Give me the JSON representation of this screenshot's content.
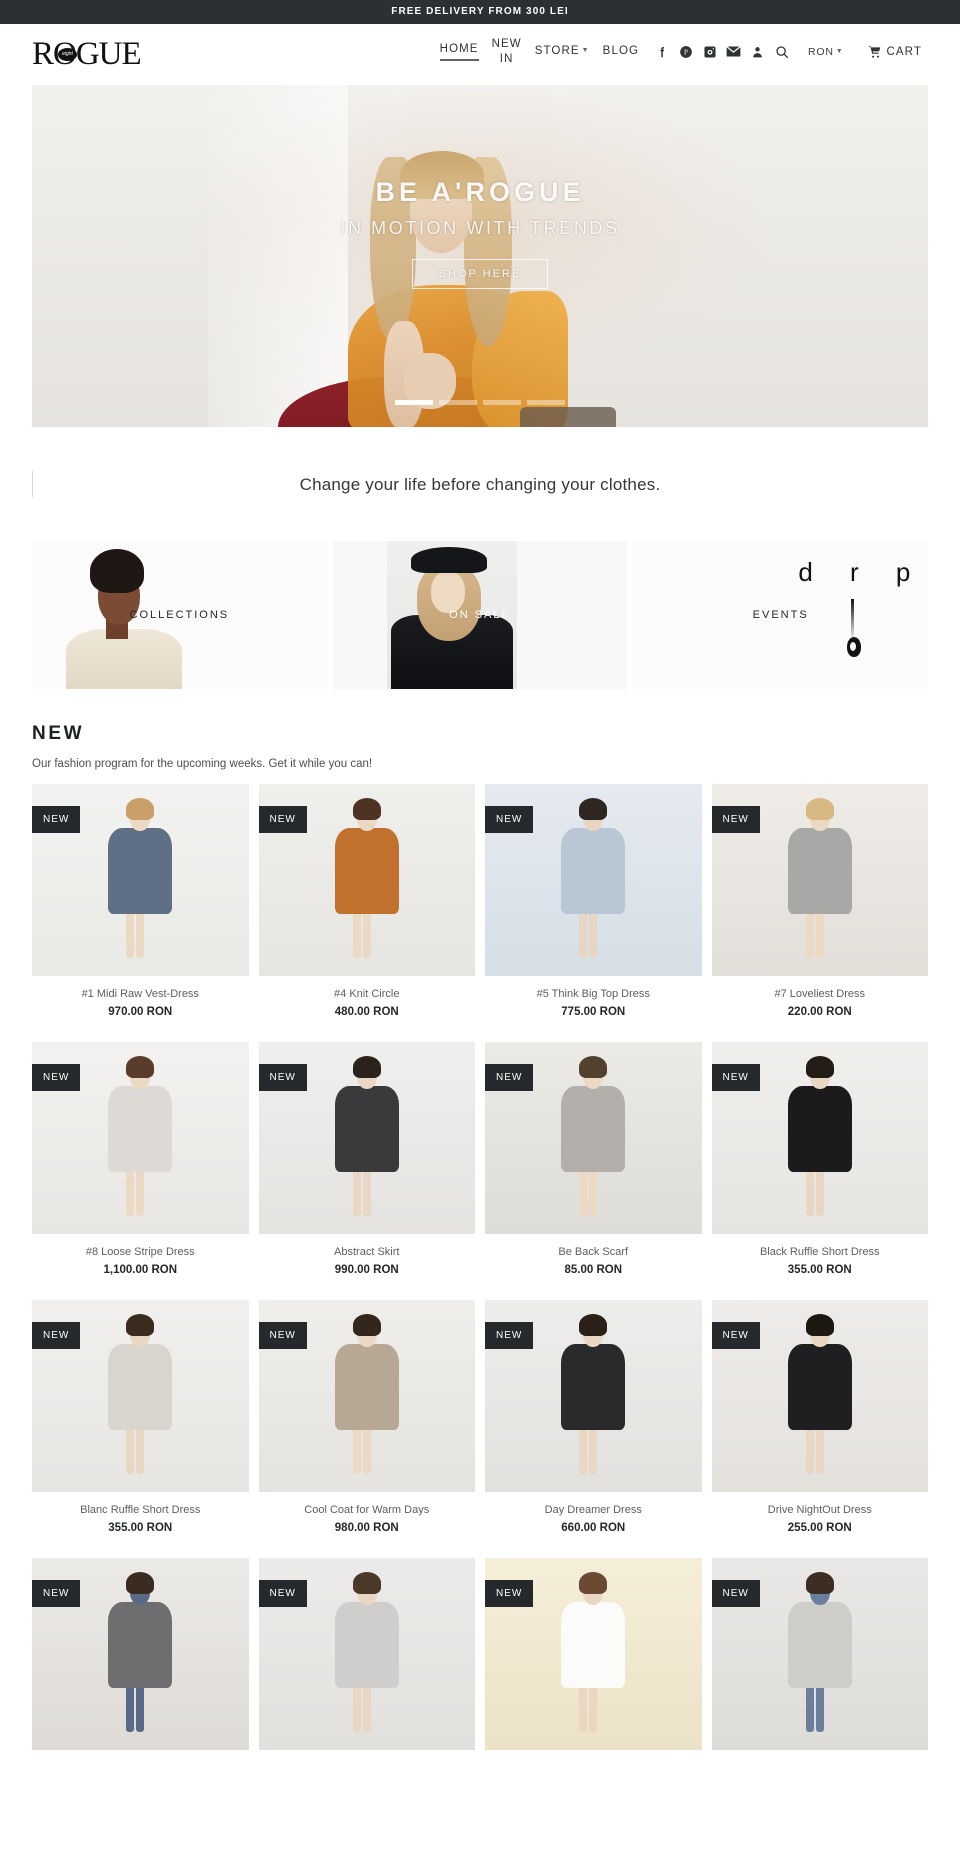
{
  "announcement": {
    "text": "FREE DELIVERY FROM 300 LEI"
  },
  "header": {
    "logo_text": "ROGUE",
    "logo_badge": "eight",
    "nav": [
      {
        "label": "HOME",
        "active": true
      },
      {
        "label": "NEW\nIN",
        "active": false
      },
      {
        "label": "STORE",
        "active": false,
        "has_caret": true
      },
      {
        "label": "BLOG",
        "active": false
      }
    ],
    "icons": [
      {
        "name": "facebook-icon"
      },
      {
        "name": "pinterest-icon"
      },
      {
        "name": "instagram-icon"
      },
      {
        "name": "email-icon"
      },
      {
        "name": "account-icon"
      },
      {
        "name": "search-icon"
      }
    ],
    "currency": "RON",
    "cart_label": "CART"
  },
  "hero": {
    "title": "BE A'ROGUE",
    "subtitle": "IN MOTION WITH TRENDS",
    "cta": "SHOP HERE",
    "slides": 4,
    "active_slide": 1
  },
  "quote": {
    "text": "Change your life before changing your clothes."
  },
  "tiles": [
    {
      "label": "COLLECTIONS"
    },
    {
      "label": "ON SALE"
    },
    {
      "label": "EVENTS",
      "art_text": "d r p"
    }
  ],
  "new_section": {
    "title": "NEW",
    "description": "Our fashion program for the upcoming weeks. Get it while you can!",
    "badge": "NEW",
    "products": [
      {
        "name": "#1 Midi Raw Vest-Dress",
        "price": "970.00 RON",
        "badge": "NEW"
      },
      {
        "name": "#4 Knit Circle",
        "price": "480.00 RON",
        "badge": "NEW"
      },
      {
        "name": "#5 Think Big Top Dress",
        "price": "775.00 RON",
        "badge": "NEW"
      },
      {
        "name": "#7 Loveliest Dress",
        "price": "220.00 RON",
        "badge": "NEW"
      },
      {
        "name": "#8 Loose Stripe Dress",
        "price": "1,100.00 RON",
        "badge": "NEW"
      },
      {
        "name": "Abstract Skirt",
        "price": "990.00 RON",
        "badge": "NEW"
      },
      {
        "name": "Be Back Scarf",
        "price": "85.00 RON",
        "badge": "NEW"
      },
      {
        "name": "Black Ruffle Short Dress",
        "price": "355.00 RON",
        "badge": "NEW"
      },
      {
        "name": "Blanc Ruffle Short Dress",
        "price": "355.00 RON",
        "badge": "NEW"
      },
      {
        "name": "Cool Coat for Warm Days",
        "price": "980.00 RON",
        "badge": "NEW"
      },
      {
        "name": "Day Dreamer Dress",
        "price": "660.00 RON",
        "badge": "NEW"
      },
      {
        "name": "Drive NightOut Dress",
        "price": "255.00 RON",
        "badge": "NEW"
      },
      {
        "name": "",
        "price": "",
        "badge": "NEW"
      },
      {
        "name": "",
        "price": "",
        "badge": "NEW"
      },
      {
        "name": "",
        "price": "",
        "badge": "NEW"
      },
      {
        "name": "",
        "price": "",
        "badge": "NEW"
      }
    ]
  },
  "colors": {
    "dark": "#2b3033",
    "badge": "#26292b",
    "text": "#3a3a3a",
    "muted": "#5a5f62"
  }
}
